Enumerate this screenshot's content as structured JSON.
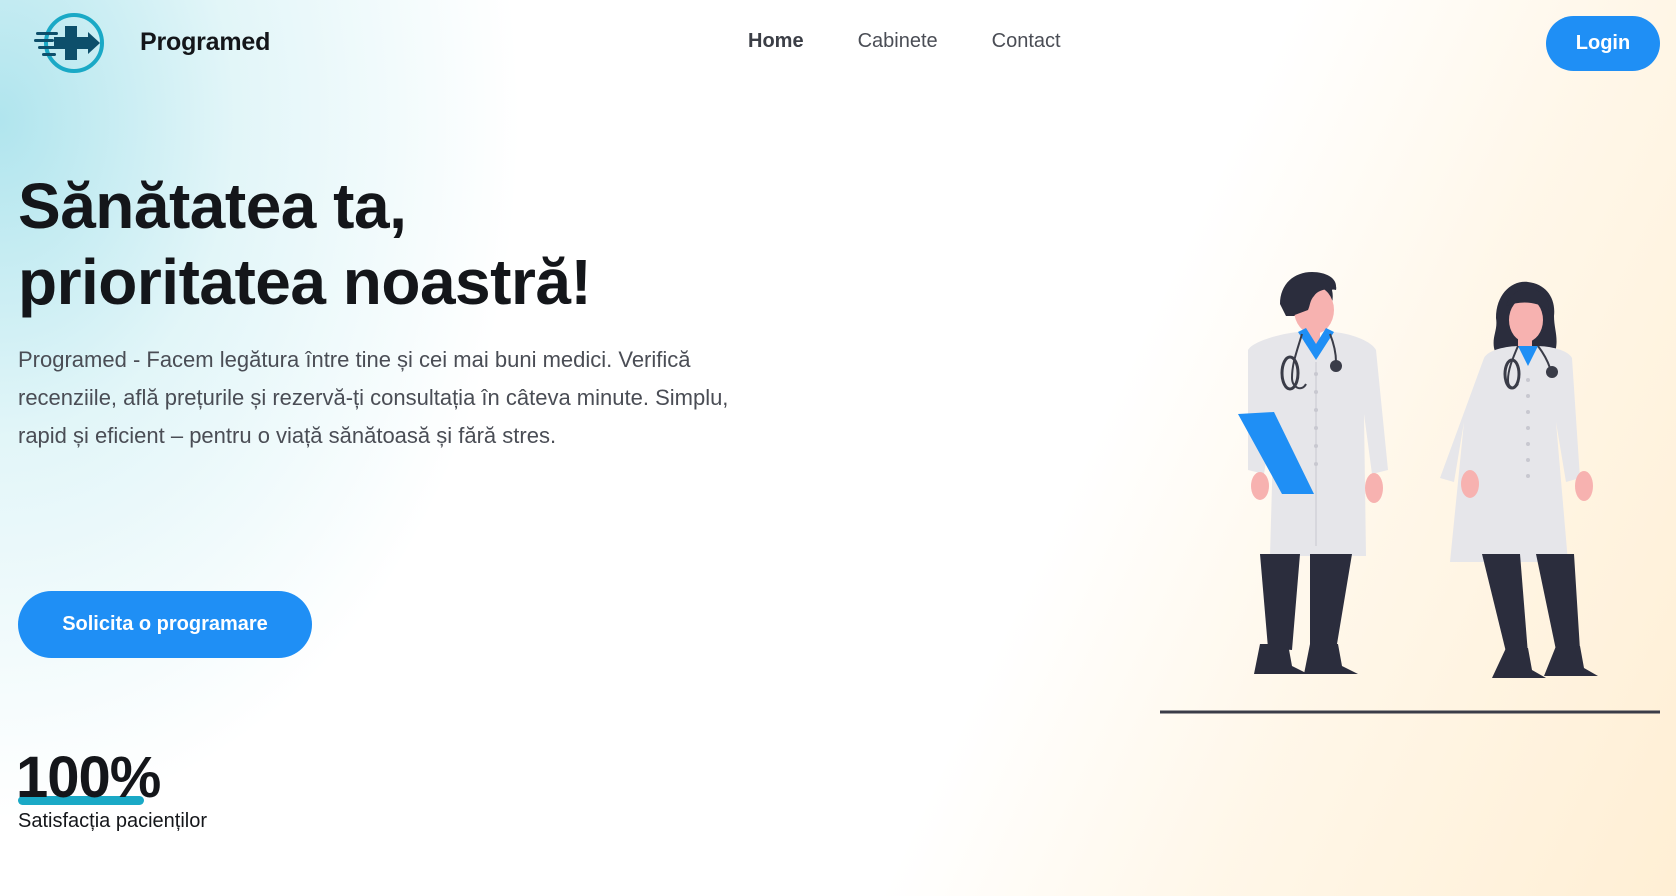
{
  "header": {
    "brand": "Programed",
    "nav": [
      {
        "label": "Home",
        "active": true
      },
      {
        "label": "Cabinete",
        "active": false
      },
      {
        "label": "Contact",
        "active": false
      }
    ],
    "login_label": "Login"
  },
  "hero": {
    "title_line1": "Sănătatea ta,",
    "title_line2": "prioritatea noastră!",
    "description": "Programed - Facem legătura între tine și cei mai buni medici. Verifică recenziile, află prețurile și rezervă-ți consultația în câteva minute. Simplu, rapid și eficient – pentru o viață sănătoasă și fără stres.",
    "cta_label": "Solicita o programare"
  },
  "stats": {
    "value": "100%",
    "label": "Satisfacția pacienților"
  },
  "icons": {
    "logo": "medical-cross-logo-icon",
    "illustration": "doctors-illustration"
  },
  "colors": {
    "accent": "#1f8ff5",
    "teal": "#1aa9c6",
    "logo_dark": "#0d4f6b",
    "text_dark": "#14161a",
    "text_muted": "#4a4d55"
  }
}
